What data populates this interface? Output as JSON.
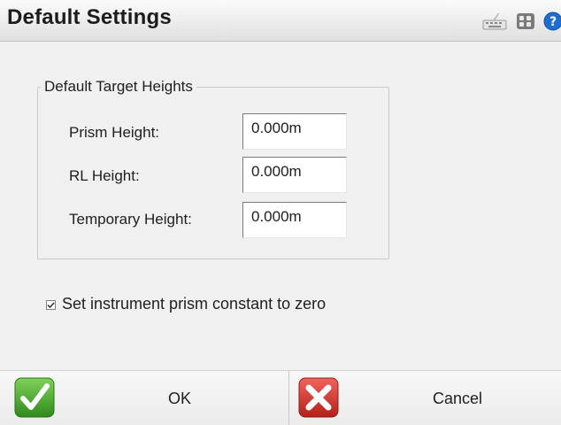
{
  "window": {
    "title": "Default Settings",
    "toolbar_icons": [
      "keyboard-icon",
      "grid-icon",
      "help-icon"
    ]
  },
  "group": {
    "legend": "Default Target Heights",
    "fields": [
      {
        "label": "Prism Height:",
        "value": "0.000m"
      },
      {
        "label": "RL Height:",
        "value": "0.000m"
      },
      {
        "label": "Temporary Height:",
        "value": "0.000m"
      }
    ]
  },
  "checkbox": {
    "label": "Set instrument prism constant to zero",
    "checked": true
  },
  "buttons": {
    "ok_label": "OK",
    "cancel_label": "Cancel"
  },
  "colors": {
    "ok_green": "#4aa82a",
    "cancel_red": "#d6332b",
    "help_blue": "#1e6fd0"
  }
}
